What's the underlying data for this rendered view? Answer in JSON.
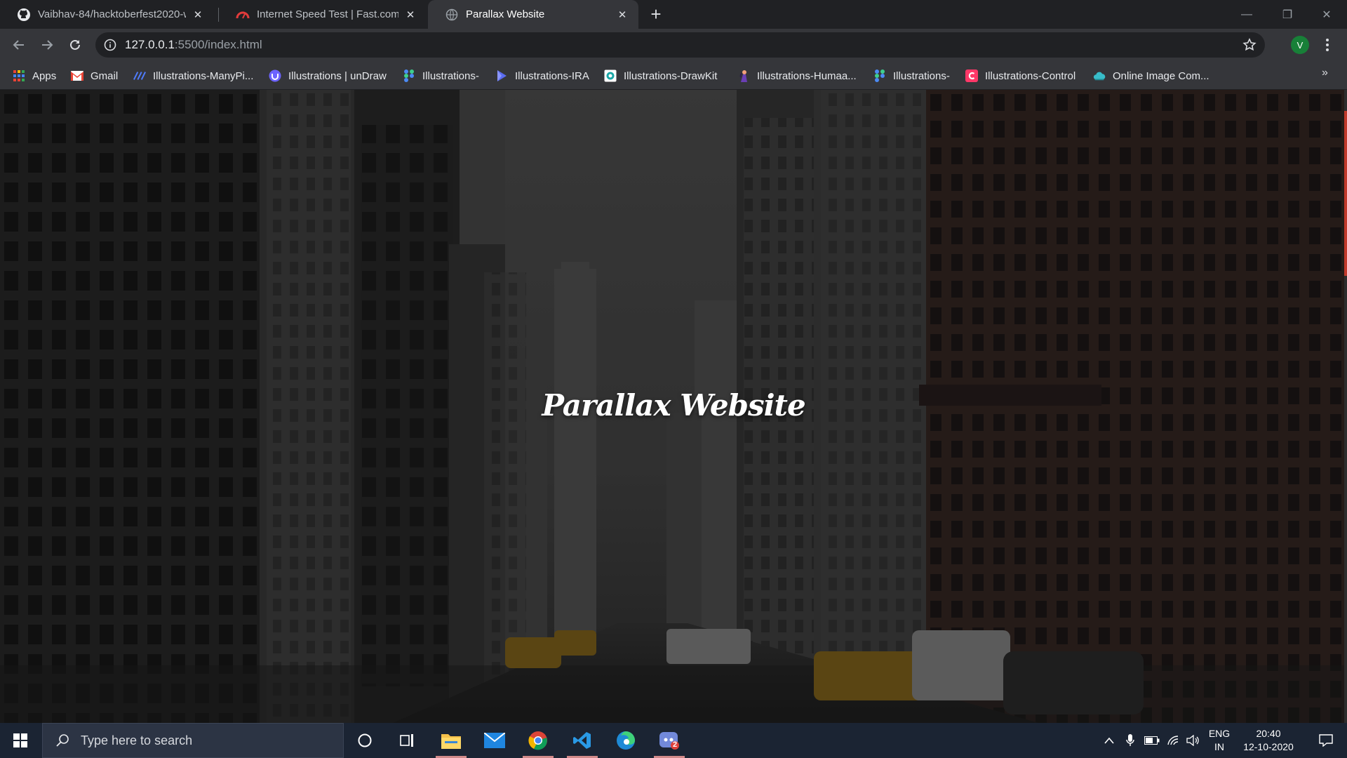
{
  "browser": {
    "tabs": [
      {
        "title": "Vaibhav-84/hacktoberfest2020-w",
        "icon": "github-icon",
        "active": false
      },
      {
        "title": "Internet Speed Test | Fast.com",
        "icon": "fast-icon",
        "active": false
      },
      {
        "title": "Parallax Website",
        "icon": "globe-icon",
        "active": true
      }
    ],
    "close_glyph": "✕",
    "new_tab_glyph": "+",
    "window_controls": {
      "minimize": "—",
      "restore": "❐",
      "close": "✕"
    },
    "address": {
      "host": "127.0.0.1",
      "path": ":5500/index.html"
    },
    "profile_initial": "V",
    "bookmarks": [
      {
        "label": "Apps",
        "icon": "apps-grid-icon"
      },
      {
        "label": "Gmail",
        "icon": "gmail-icon"
      },
      {
        "label": "Illustrations-ManyPi...",
        "icon": "manypixels-icon"
      },
      {
        "label": "Illustrations | unDraw",
        "icon": "undraw-icon"
      },
      {
        "label": "Illustrations-",
        "icon": "figma-icon"
      },
      {
        "label": "Illustrations-IRA",
        "icon": "ira-icon"
      },
      {
        "label": "Illustrations-DrawKit",
        "icon": "drawkit-icon"
      },
      {
        "label": "Illustrations-Humaa...",
        "icon": "humaaans-icon"
      },
      {
        "label": "Illustrations-",
        "icon": "figma-icon"
      },
      {
        "label": "Illustrations-Control",
        "icon": "control-icon"
      },
      {
        "label": "Online Image Com...",
        "icon": "cloud-icon"
      }
    ],
    "bookmarks_overflow": "»"
  },
  "page": {
    "title": "Parallax Website"
  },
  "taskbar": {
    "search_placeholder": "Type here to search",
    "apps": [
      "cortana-icon",
      "task-view-icon",
      "file-explorer-icon",
      "mail-icon",
      "chrome-icon",
      "vscode-icon",
      "edge-icon",
      "discord-icon"
    ],
    "discord_badge": "2",
    "language": {
      "line1": "ENG",
      "line2": "IN"
    },
    "clock": {
      "time": "20:40",
      "date": "12-10-2020"
    }
  },
  "colors": {
    "accent_green": "#188038",
    "scroll_thumb": "#c0392b",
    "taskbar": "#1b2433"
  }
}
